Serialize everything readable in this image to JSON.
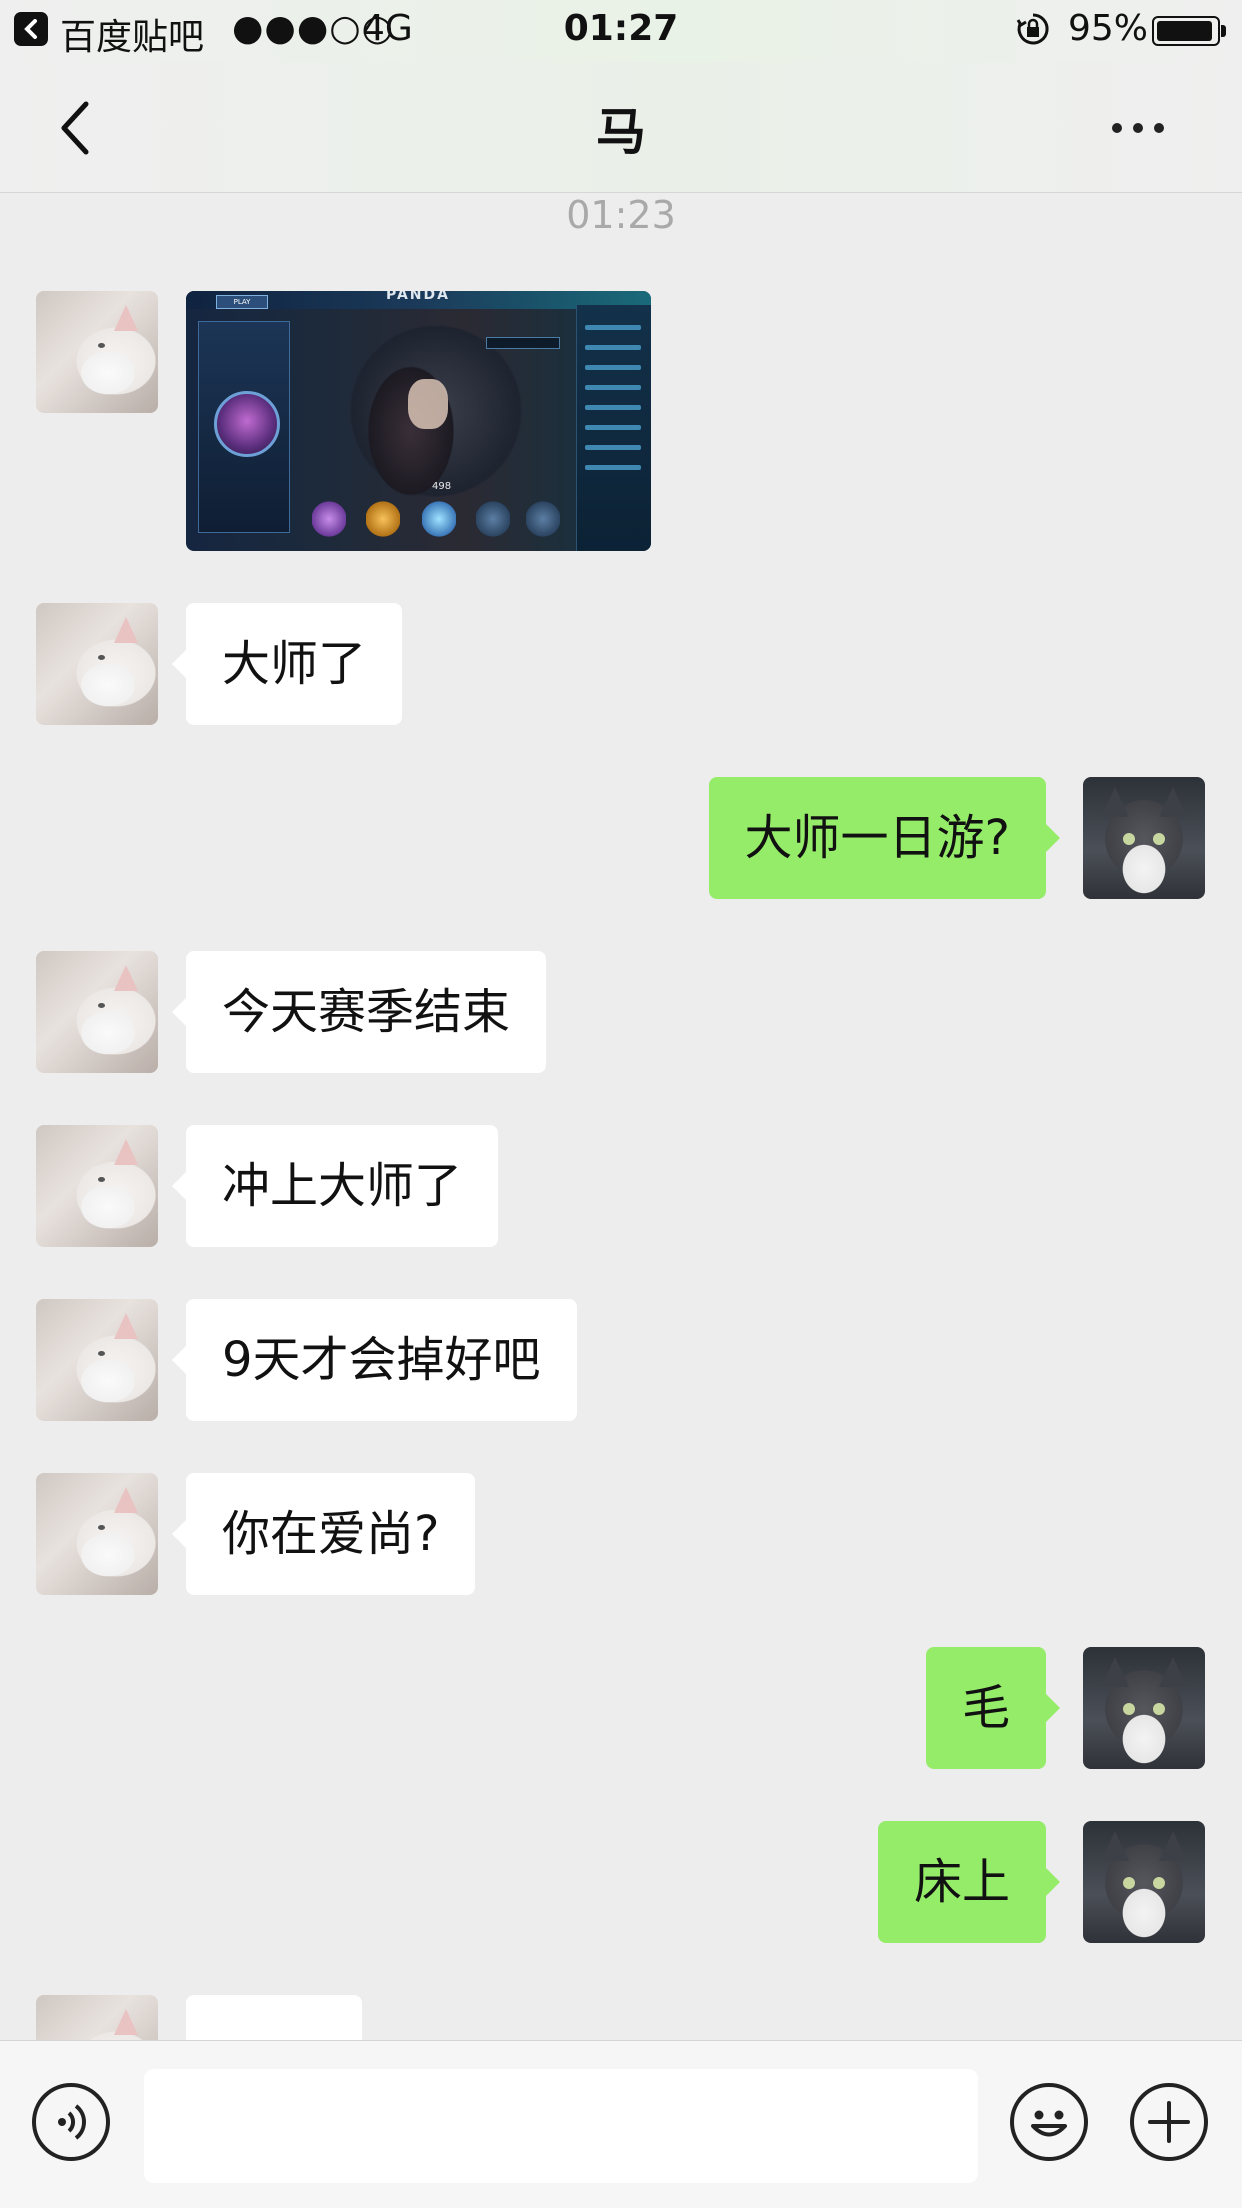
{
  "status_bar": {
    "back_app": "百度贴吧",
    "signal": "●●●○○",
    "network": "4G",
    "time": "01:27",
    "battery_percent": "95%",
    "battery_level": 0.95
  },
  "nav": {
    "title": "马"
  },
  "chat": {
    "timestamp": "01:23",
    "messages": [
      {
        "side": "left",
        "type": "image"
      },
      {
        "side": "left",
        "type": "text",
        "text": "大师了"
      },
      {
        "side": "right",
        "type": "text",
        "text": "大师一日游?"
      },
      {
        "side": "left",
        "type": "text",
        "text": "今天赛季结束"
      },
      {
        "side": "left",
        "type": "text",
        "text": "冲上大师了"
      },
      {
        "side": "left",
        "type": "text",
        "text": "9天才会掉好吧"
      },
      {
        "side": "left",
        "type": "text",
        "text": "你在爱尚?"
      },
      {
        "side": "right",
        "type": "text",
        "text": "毛"
      },
      {
        "side": "right",
        "type": "text",
        "text": "床上"
      },
      {
        "side": "left",
        "type": "text",
        "text": ""
      }
    ],
    "image_message": {
      "banner_text": "PANDA",
      "play_label": "PLAY",
      "score": "498"
    }
  },
  "input_bar": {
    "value": "",
    "placeholder": ""
  },
  "colors": {
    "bubble_self": "#95ec69",
    "bubble_other": "#ffffff",
    "background": "#ededed",
    "timestamp": "#a9a9a9"
  },
  "icons": {
    "nav_back": "chevron-left-icon",
    "nav_more": "more-dots-icon",
    "voice": "voice-icon",
    "emoji": "emoji-icon",
    "plus": "plus-icon"
  }
}
